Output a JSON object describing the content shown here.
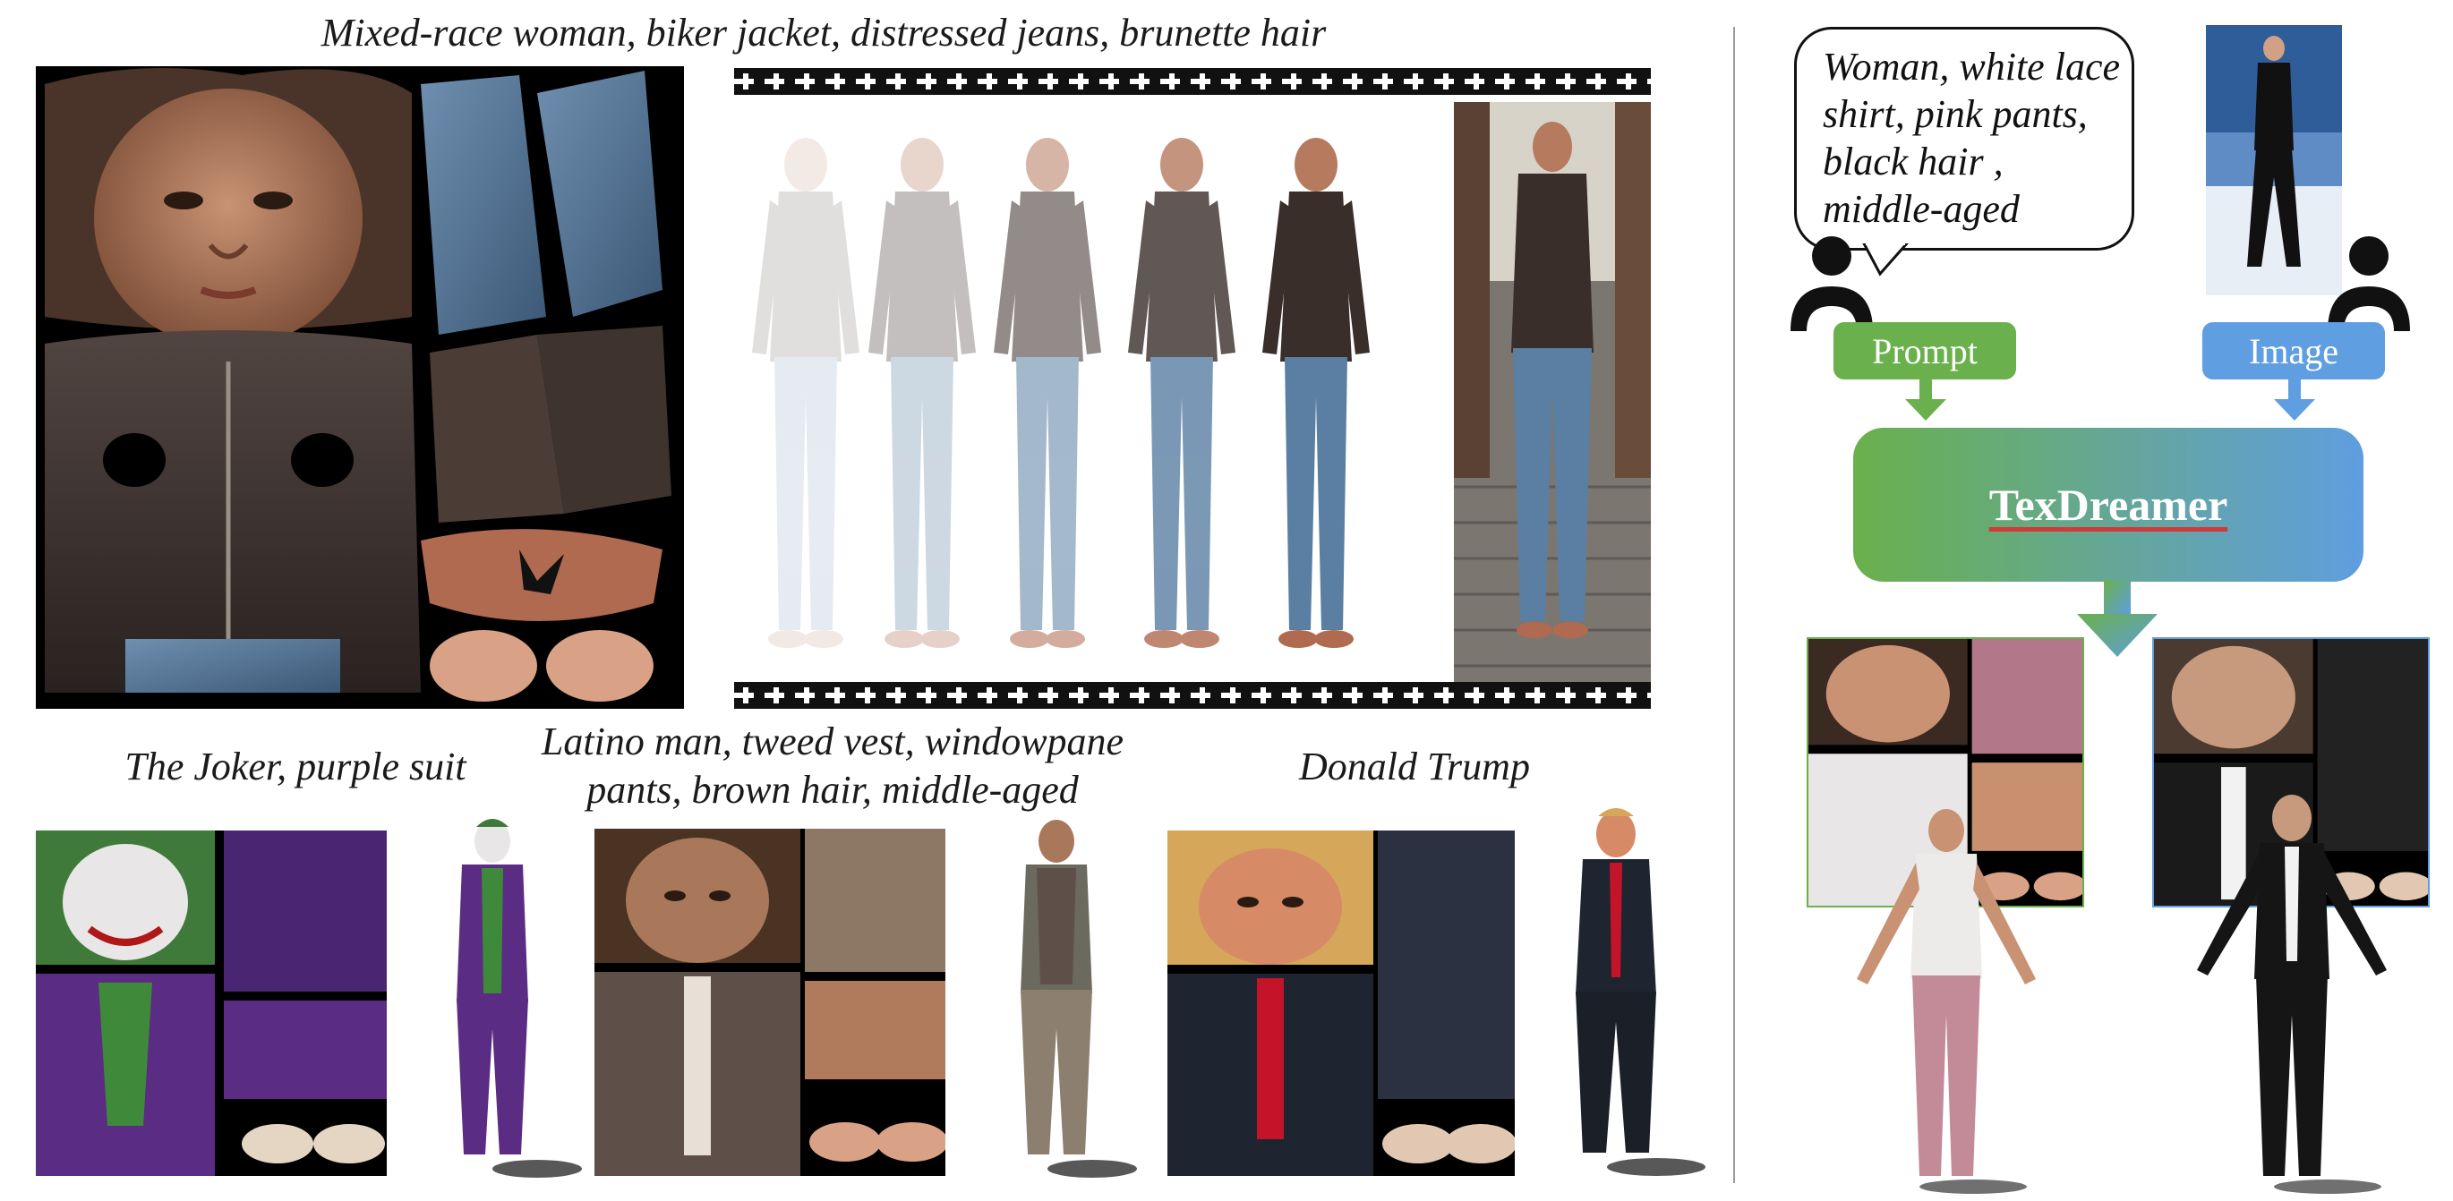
{
  "top_caption": "Mixed-race woman, biker jacket, distressed jeans, brunette hair",
  "bottom_captions": {
    "joker": "The Joker, purple suit",
    "latino_line1": "Latino man, tweed vest, windowpane",
    "latino_line2": "pants, brown hair, middle-aged",
    "trump": "Donald Trump"
  },
  "pipeline": {
    "prompt_text": [
      "Woman, white lace",
      "shirt, pink pants,",
      "black hair ,",
      "middle-aged"
    ],
    "prompt_label": "Prompt",
    "image_label": "Image",
    "model_name": "TexDreamer"
  },
  "icons": {
    "user_icon_left": "person-icon",
    "user_icon_right": "person-icon",
    "arrow": "arrow-down-icon"
  },
  "colors": {
    "prompt_green": "#6ab04c",
    "image_blue": "#5f9ee0",
    "joker_purple": "#5b2c83",
    "leather_brown": "#3b2f2a",
    "denim_blue": "#5a7fa3"
  }
}
